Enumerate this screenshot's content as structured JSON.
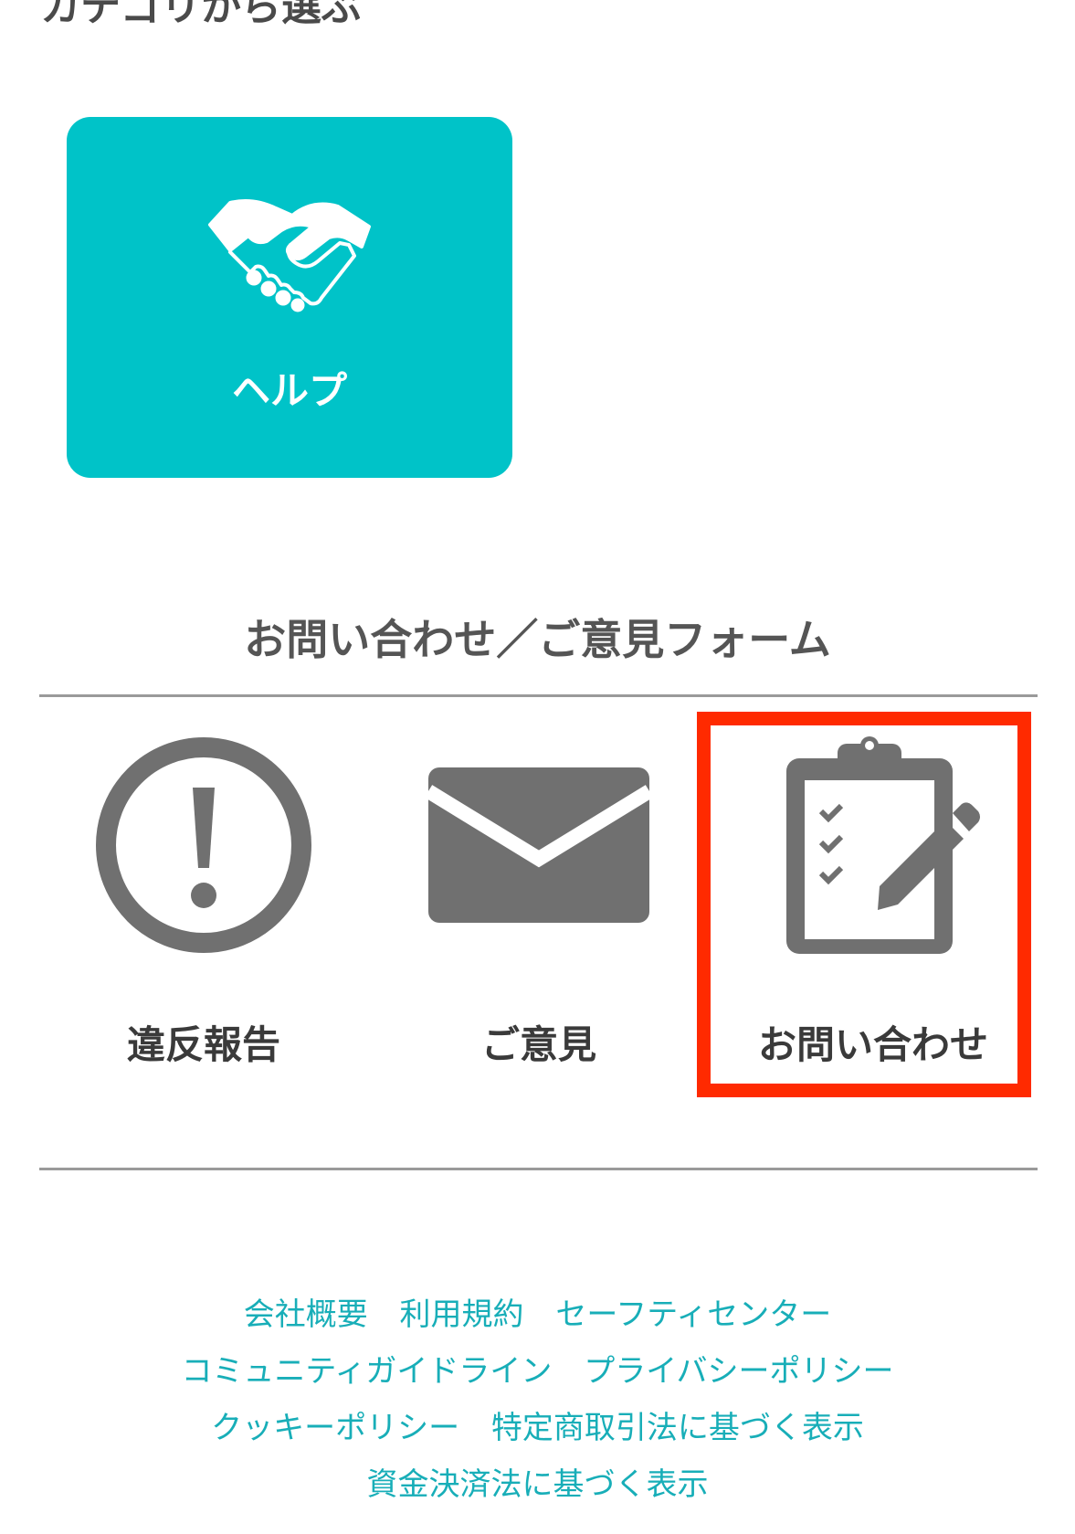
{
  "category": {
    "heading": "カテゴリから選ぶ",
    "card": {
      "label": "ヘルプ",
      "icon": "handshake-icon",
      "color": "#00c3c8"
    }
  },
  "forms": {
    "heading": "お問い合わせ／ご意見フォーム",
    "items": [
      {
        "label": "違反報告",
        "icon": "exclamation-circle-icon"
      },
      {
        "label": "ご意見",
        "icon": "envelope-icon"
      },
      {
        "label": "お問い合わせ",
        "icon": "clipboard-pencil-icon"
      }
    ],
    "highlight_color": "#ff2a00"
  },
  "footer": {
    "links": [
      [
        "会社概要",
        "利用規約",
        "セーフティセンター"
      ],
      [
        "コミュニティガイドライン",
        "プライバシーポリシー"
      ],
      [
        "クッキーポリシー",
        "特定商取引法に基づく表示"
      ],
      [
        "資金決済法に基づく表示"
      ]
    ],
    "link_color": "#18aeb8"
  }
}
